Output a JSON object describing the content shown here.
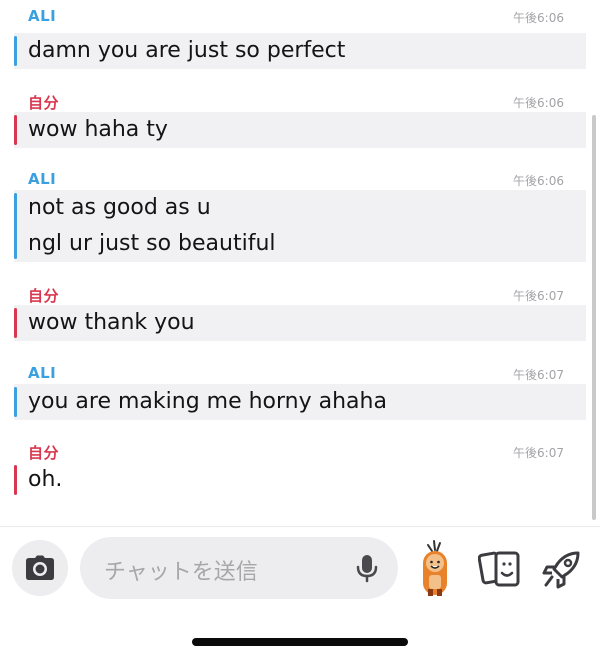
{
  "messages": [
    {
      "sender": "ALI",
      "time": "午後6:06",
      "lines": [
        "damn you are just so perfect"
      ]
    },
    {
      "sender": "自分",
      "time": "午後6:06",
      "lines": [
        "wow haha ty"
      ]
    },
    {
      "sender": "ALI",
      "time": "午後6:06",
      "lines": [
        "not as good as u",
        "ngl ur just so beautiful"
      ]
    },
    {
      "sender": "自分",
      "time": "午後6:07",
      "lines": [
        "wow thank you"
      ]
    },
    {
      "sender": "ALI",
      "time": "午後6:07",
      "lines": [
        "you are making me horny ahaha"
      ]
    },
    {
      "sender": "自分",
      "time": "午後6:07",
      "lines": [
        "oh."
      ]
    }
  ],
  "input": {
    "placeholder": "チャットを送信"
  },
  "icons": {
    "camera": "camera-icon",
    "mic": "microphone-icon",
    "bitmoji": "bitmoji-icon",
    "cards": "cards-icon",
    "rocket": "rocket-icon"
  },
  "colors": {
    "other": "#3aa0e0",
    "me": "#d8384f",
    "bubble": "#f1f1f3"
  }
}
